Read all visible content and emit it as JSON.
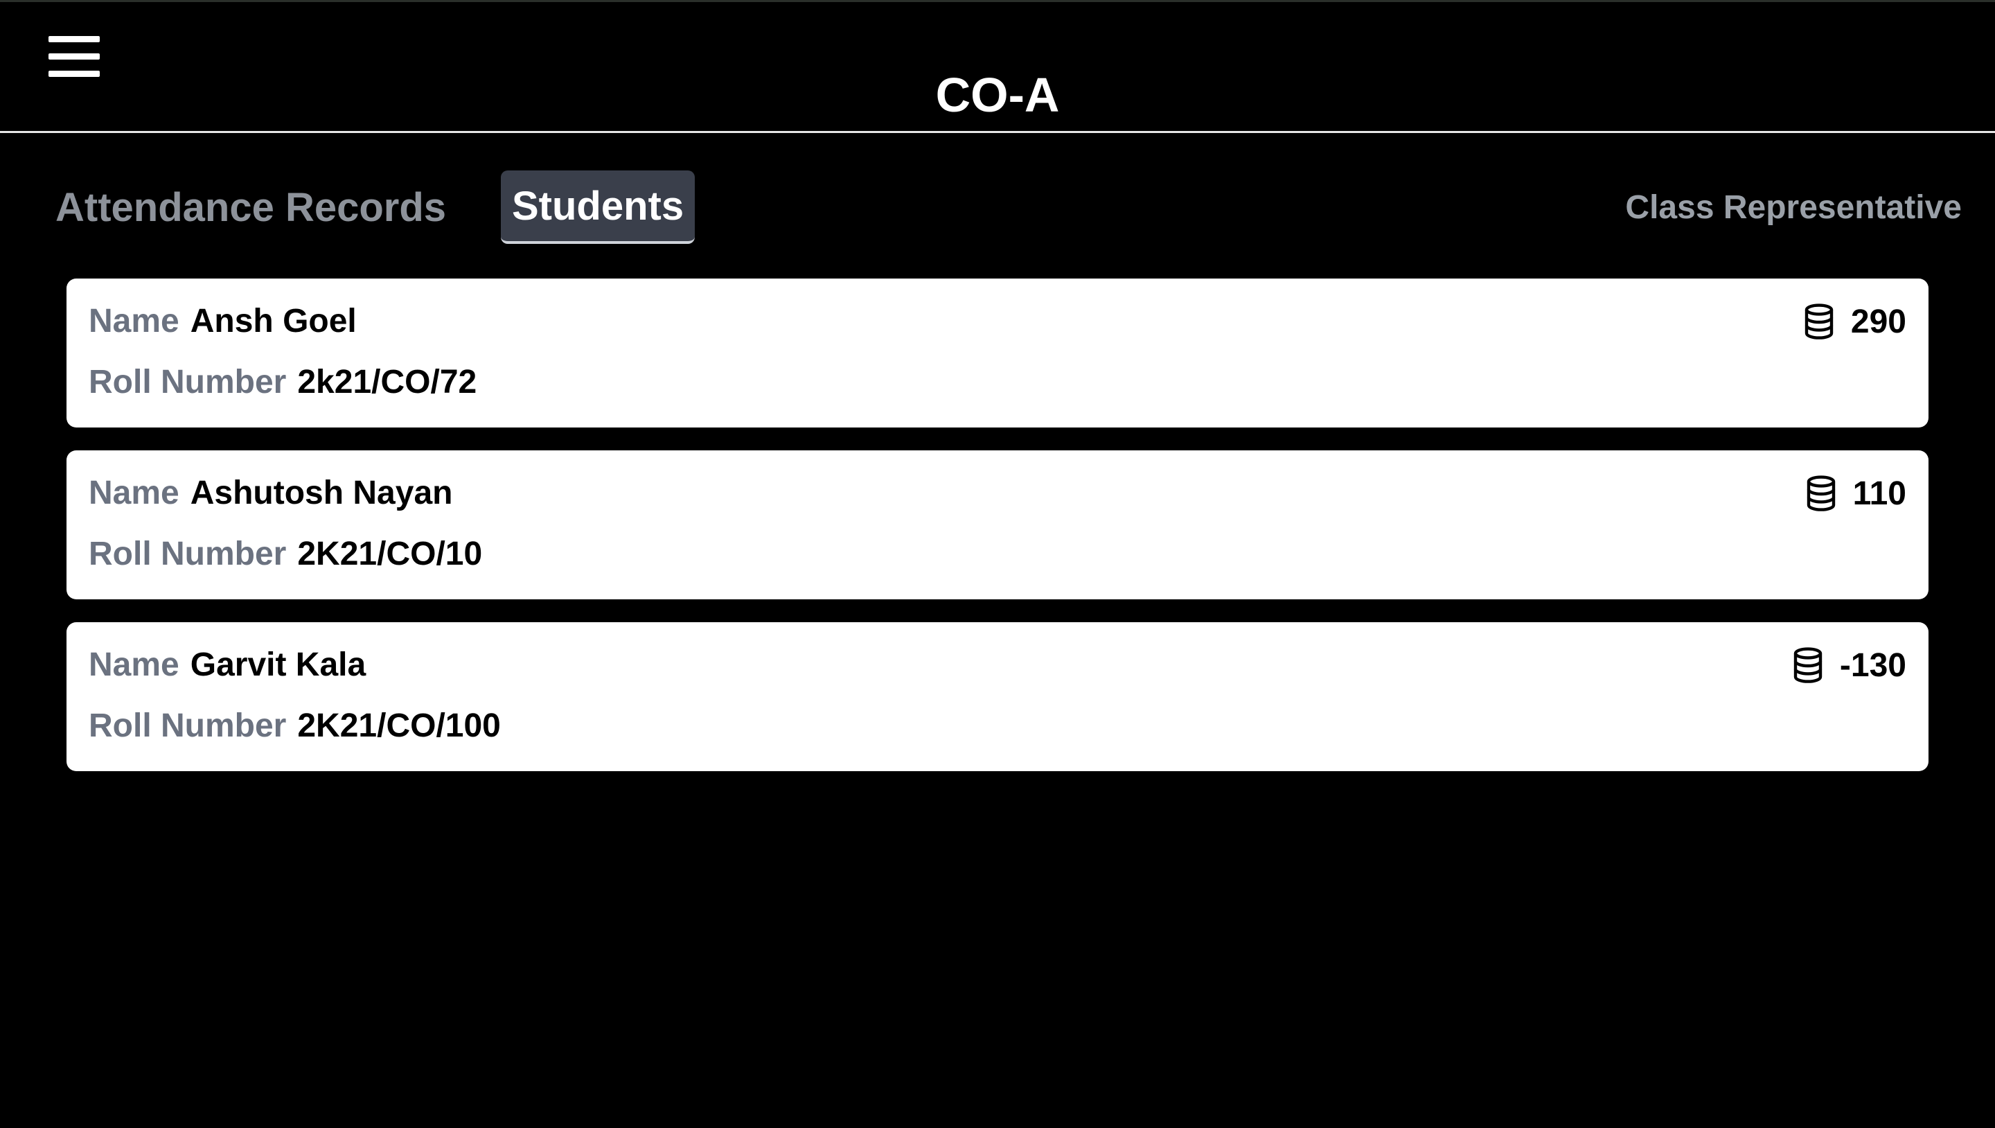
{
  "header": {
    "title": "CO-A",
    "menu_icon": "hamburger-menu-icon"
  },
  "tabs": [
    {
      "label": "Attendance Records",
      "active": false
    },
    {
      "label": "Students",
      "active": true
    }
  ],
  "role": "Class Representative",
  "field_labels": {
    "name": "Name",
    "roll": "Roll Number"
  },
  "students": [
    {
      "name": "Ansh Goel",
      "roll": "2k21/CO/72",
      "points": "290",
      "icon": "coins-stack-icon"
    },
    {
      "name": "Ashutosh Nayan",
      "roll": "2K21/CO/10",
      "points": "110",
      "icon": "coins-stack-icon"
    },
    {
      "name": "Garvit Kala",
      "roll": "2K21/CO/100",
      "points": "-130",
      "icon": "coins-stack-icon"
    }
  ],
  "colors": {
    "background": "#000000",
    "card": "#ffffff",
    "active_tab": "#3a3f4b",
    "muted_text": "#8d929a",
    "label_text": "#6b7280"
  }
}
